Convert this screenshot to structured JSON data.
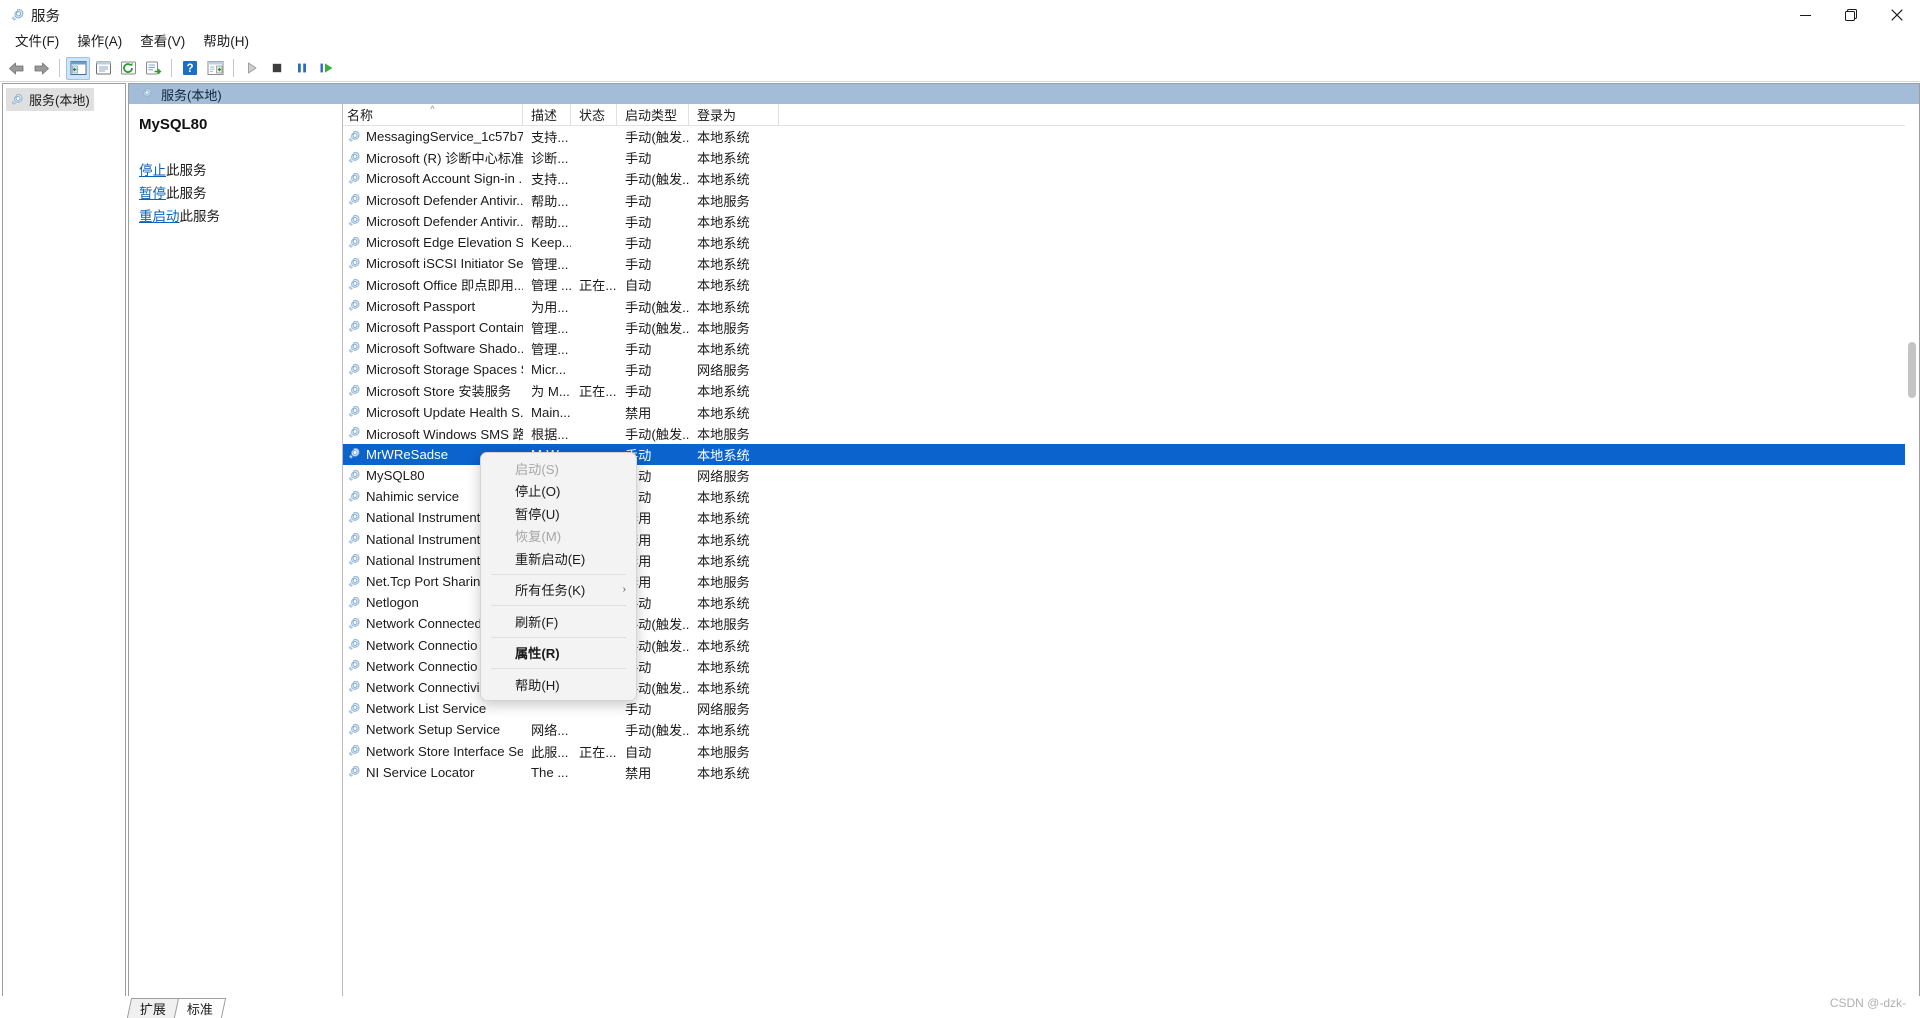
{
  "window": {
    "title": "服务",
    "icon": "services-gear-icon",
    "minimize_label": "最小化",
    "maximize_label": "最大化",
    "close_label": "关闭"
  },
  "menubar": [
    {
      "label": "文件(F)",
      "name": "menu-file"
    },
    {
      "label": "操作(A)",
      "name": "menu-action"
    },
    {
      "label": "查看(V)",
      "name": "menu-view"
    },
    {
      "label": "帮助(H)",
      "name": "menu-help"
    }
  ],
  "toolbar": [
    {
      "name": "back-button",
      "icon": "arrow-left-icon"
    },
    {
      "name": "forward-button",
      "icon": "arrow-right-icon"
    },
    {
      "name": "separator-1",
      "icon": "separator"
    },
    {
      "name": "show-hide-console-tree-button",
      "icon": "console-tree-icon"
    },
    {
      "name": "properties-button",
      "icon": "properties-icon"
    },
    {
      "name": "refresh-button",
      "icon": "refresh-icon"
    },
    {
      "name": "export-list-button",
      "icon": "export-list-icon"
    },
    {
      "name": "separator-2",
      "icon": "separator"
    },
    {
      "name": "help-button",
      "icon": "help-question-icon"
    },
    {
      "name": "show-action-pane-button",
      "icon": "action-pane-icon"
    },
    {
      "name": "separator-3",
      "icon": "separator"
    },
    {
      "name": "start-service-button",
      "icon": "play-icon"
    },
    {
      "name": "stop-service-button",
      "icon": "stop-icon"
    },
    {
      "name": "pause-service-button",
      "icon": "pause-icon"
    },
    {
      "name": "restart-service-button",
      "icon": "restart-icon"
    }
  ],
  "tree": {
    "root_label": "服务(本地)",
    "root_icon": "services-gear-icon"
  },
  "pane": {
    "header_label": "服务(本地)",
    "header_icon": "services-gear-icon",
    "header_bg": "#a3bdd8"
  },
  "detail": {
    "service_name": "MySQL80",
    "links": [
      {
        "name": "stop-service-link",
        "link_text": "停止",
        "rest_text": "此服务"
      },
      {
        "name": "pause-service-link",
        "link_text": "暂停",
        "rest_text": "此服务"
      },
      {
        "name": "restart-service-link",
        "link_text": "重启动",
        "rest_text": "此服务"
      }
    ]
  },
  "list": {
    "columns": [
      {
        "key": "name",
        "label": "名称",
        "sorted": true,
        "sort_caret": "^"
      },
      {
        "key": "desc",
        "label": "描述",
        "sorted": false
      },
      {
        "key": "status",
        "label": "状态",
        "sorted": false
      },
      {
        "key": "start",
        "label": "启动类型",
        "sorted": false
      },
      {
        "key": "logon",
        "label": "登录为",
        "sorted": false
      }
    ],
    "selected_index": 15,
    "selection_color": "#0b63ce",
    "rows": [
      {
        "name": "MessagingService_1c57b7",
        "desc": "支持...",
        "status": "",
        "start": "手动(触发...",
        "logon": "本地系统"
      },
      {
        "name": "Microsoft (R) 诊断中心标准...",
        "desc": "诊断...",
        "status": "",
        "start": "手动",
        "logon": "本地系统"
      },
      {
        "name": "Microsoft Account Sign-in ...",
        "desc": "支持...",
        "status": "",
        "start": "手动(触发...",
        "logon": "本地系统"
      },
      {
        "name": "Microsoft Defender Antivir...",
        "desc": "帮助...",
        "status": "",
        "start": "手动",
        "logon": "本地服务"
      },
      {
        "name": "Microsoft Defender Antivir...",
        "desc": "帮助...",
        "status": "",
        "start": "手动",
        "logon": "本地系统"
      },
      {
        "name": "Microsoft Edge Elevation S...",
        "desc": "Keep...",
        "status": "",
        "start": "手动",
        "logon": "本地系统"
      },
      {
        "name": "Microsoft iSCSI Initiator Ser...",
        "desc": "管理...",
        "status": "",
        "start": "手动",
        "logon": "本地系统"
      },
      {
        "name": "Microsoft Office 即点即用...",
        "desc": "管理 ...",
        "status": "正在...",
        "start": "自动",
        "logon": "本地系统"
      },
      {
        "name": "Microsoft Passport",
        "desc": "为用...",
        "status": "",
        "start": "手动(触发...",
        "logon": "本地系统"
      },
      {
        "name": "Microsoft Passport Container",
        "desc": "管理...",
        "status": "",
        "start": "手动(触发...",
        "logon": "本地服务"
      },
      {
        "name": "Microsoft Software Shado...",
        "desc": "管理...",
        "status": "",
        "start": "手动",
        "logon": "本地系统"
      },
      {
        "name": "Microsoft Storage Spaces S...",
        "desc": "Micr...",
        "status": "",
        "start": "手动",
        "logon": "网络服务"
      },
      {
        "name": "Microsoft Store 安装服务",
        "desc": "为 M...",
        "status": "正在...",
        "start": "手动",
        "logon": "本地系统"
      },
      {
        "name": "Microsoft Update Health S...",
        "desc": "Main...",
        "status": "",
        "start": "禁用",
        "logon": "本地系统"
      },
      {
        "name": "Microsoft Windows SMS 路...",
        "desc": "根据...",
        "status": "",
        "start": "手动(触发...",
        "logon": "本地服务"
      },
      {
        "name": "MrWReSadse",
        "desc": "MrW...",
        "status": "",
        "start": "手动",
        "logon": "本地系统"
      },
      {
        "name": "MySQL80",
        "desc": "",
        "status": "",
        "start": "自动",
        "logon": "网络服务"
      },
      {
        "name": "Nahimic service",
        "desc": "",
        "status": "",
        "start": "自动",
        "logon": "本地系统"
      },
      {
        "name": "National Instrument",
        "desc": "",
        "status": "",
        "start": "禁用",
        "logon": "本地系统"
      },
      {
        "name": "National Instrument",
        "desc": "",
        "status": "",
        "start": "禁用",
        "logon": "本地系统"
      },
      {
        "name": "National Instrument",
        "desc": "",
        "status": "",
        "start": "禁用",
        "logon": "本地系统"
      },
      {
        "name": "Net.Tcp Port Sharin",
        "desc": "",
        "status": "",
        "start": "禁用",
        "logon": "本地服务"
      },
      {
        "name": "Netlogon",
        "desc": "",
        "status": "",
        "start": "手动",
        "logon": "本地系统"
      },
      {
        "name": "Network Connected",
        "desc": "",
        "status": "",
        "start": "手动(触发...",
        "logon": "本地服务"
      },
      {
        "name": "Network Connectio",
        "desc": "",
        "status": "",
        "start": "手动(触发...",
        "logon": "本地系统"
      },
      {
        "name": "Network Connectio",
        "desc": "",
        "status": "",
        "start": "手动",
        "logon": "本地系统"
      },
      {
        "name": "Network Connectivi",
        "desc": "",
        "status": "",
        "start": "手动(触发...",
        "logon": "本地系统"
      },
      {
        "name": "Network List Service",
        "desc": "",
        "status": "",
        "start": "手动",
        "logon": "网络服务"
      },
      {
        "name": "Network Setup Service",
        "desc": "网络...",
        "status": "",
        "start": "手动(触发...",
        "logon": "本地系统"
      },
      {
        "name": "Network Store Interface Se...",
        "desc": "此服...",
        "status": "正在...",
        "start": "自动",
        "logon": "本地服务"
      },
      {
        "name": "NI Service Locator",
        "desc": "The ...",
        "status": "",
        "start": "禁用",
        "logon": "本地系统"
      }
    ]
  },
  "context_menu": {
    "items": [
      {
        "name": "ctx-start",
        "label": "启动(S)",
        "disabled": true,
        "bold": false,
        "submenu": false
      },
      {
        "name": "ctx-stop",
        "label": "停止(O)",
        "disabled": false,
        "bold": false,
        "submenu": false
      },
      {
        "name": "ctx-pause",
        "label": "暂停(U)",
        "disabled": false,
        "bold": false,
        "submenu": false
      },
      {
        "name": "ctx-resume",
        "label": "恢复(M)",
        "disabled": true,
        "bold": false,
        "submenu": false
      },
      {
        "name": "ctx-restart",
        "label": "重新启动(E)",
        "disabled": false,
        "bold": false,
        "submenu": false
      },
      {
        "name": "ctx-separator-1",
        "label": "",
        "separator": true
      },
      {
        "name": "ctx-all-tasks",
        "label": "所有任务(K)",
        "disabled": false,
        "bold": false,
        "submenu": true,
        "submenu_arrow": "›"
      },
      {
        "name": "ctx-separator-2",
        "label": "",
        "separator": true
      },
      {
        "name": "ctx-refresh",
        "label": "刷新(F)",
        "disabled": false,
        "bold": false,
        "submenu": false
      },
      {
        "name": "ctx-separator-3",
        "label": "",
        "separator": true
      },
      {
        "name": "ctx-properties",
        "label": "属性(R)",
        "disabled": false,
        "bold": true,
        "submenu": false
      },
      {
        "name": "ctx-separator-4",
        "label": "",
        "separator": true
      },
      {
        "name": "ctx-help",
        "label": "帮助(H)",
        "disabled": false,
        "bold": false,
        "submenu": false
      }
    ]
  },
  "tabs": [
    {
      "name": "tab-extended",
      "label": "扩展",
      "active": false
    },
    {
      "name": "tab-standard",
      "label": "标准",
      "active": true
    }
  ],
  "watermark": {
    "text": "CSDN @-dzk-"
  }
}
